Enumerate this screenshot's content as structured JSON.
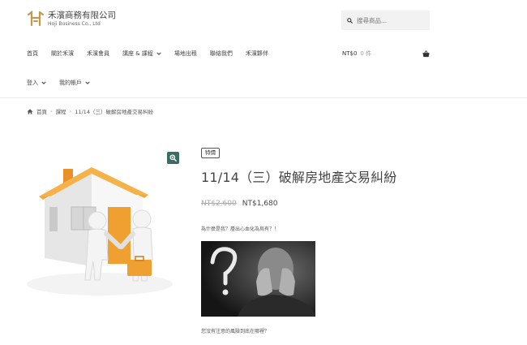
{
  "brand": {
    "name": "禾濱商務有限公司",
    "subtitle": "Hoji Business Co., Ltd"
  },
  "search": {
    "placeholder": "搜尋商品..."
  },
  "nav": {
    "items": [
      {
        "label": "首頁"
      },
      {
        "label": "關於禾濱"
      },
      {
        "label": "禾濱會員"
      },
      {
        "label": "講座 & 課程"
      },
      {
        "label": "場地出租"
      },
      {
        "label": "聯絡我們"
      },
      {
        "label": "禾濱夥伴"
      }
    ],
    "row2": [
      {
        "label": "登入"
      },
      {
        "label": "我的帳戶"
      }
    ]
  },
  "cart": {
    "total": "NT$0",
    "count": "0 件"
  },
  "breadcrumb": {
    "home": "首頁",
    "category": "課程",
    "current": "11/14（三）破解房地產交易糾紛"
  },
  "product": {
    "badge": "特價",
    "title": "11/14（三）破解房地產交易糾紛",
    "price_old": "NT$2,600",
    "price_new": "NT$1,680",
    "desc1": "為什麼是我？層出心血化為烏有？！",
    "desc2": "您沒有注意的風險到底在哪裡？"
  },
  "colors": {
    "accent": "#3c6a64",
    "roof": "#f2a93b",
    "door": "#f0a030"
  }
}
